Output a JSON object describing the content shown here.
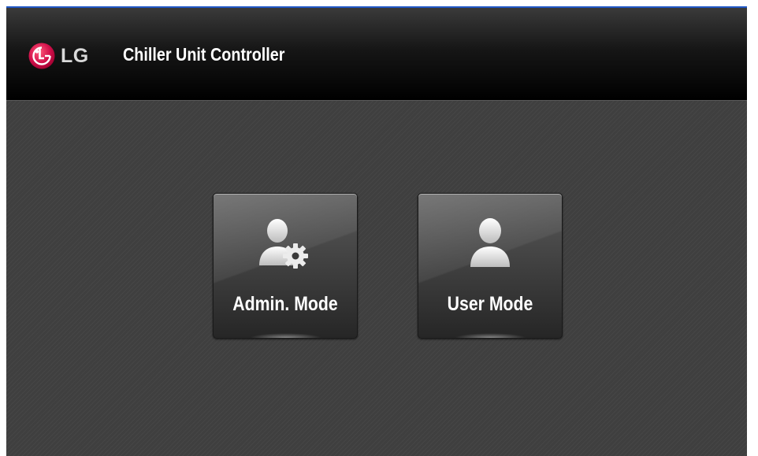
{
  "header": {
    "brand": "LG",
    "title": "Chiller Unit Controller"
  },
  "modes": [
    {
      "label": "Admin. Mode",
      "icon": "admin-user-gear-icon"
    },
    {
      "label": "User Mode",
      "icon": "user-icon"
    }
  ],
  "colors": {
    "brand_red": "#c4003a",
    "frame_accent": "#1f57c5",
    "header_bg": "#000000",
    "body_bg": "#3f3f3f"
  }
}
